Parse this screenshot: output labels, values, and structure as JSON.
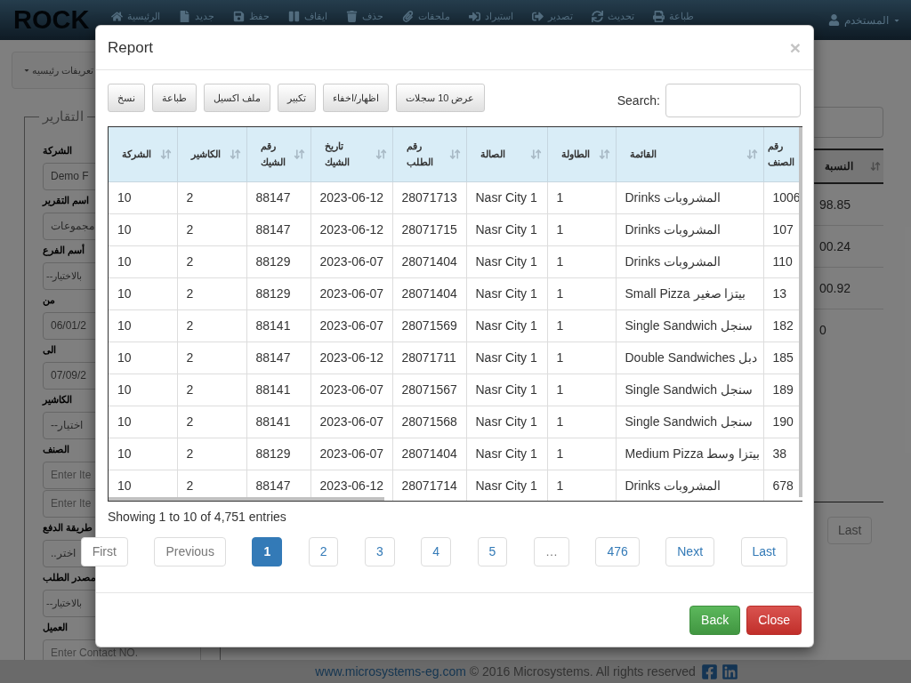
{
  "navbar": {
    "user": "المستخدم",
    "items": [
      "طباعة",
      "تحديث",
      "تصدير",
      "استيراد",
      "ملحقات",
      "حذف",
      "ايقاف",
      "حفظ",
      "جديد",
      "الرئيسية"
    ],
    "logo": "ROCK"
  },
  "subnav": {
    "menu": "تعريفات رئيسيه"
  },
  "reports_form": {
    "legend": "التقارير",
    "fields": [
      {
        "label": "الشركة",
        "inputs": [
          {
            "kind": "text",
            "value": "Demo F"
          }
        ]
      },
      {
        "label": "اسم التقرير",
        "inputs": [
          {
            "kind": "text",
            "value": "مجموعات"
          }
        ]
      },
      {
        "label": "أسم الفرع",
        "inputs": [
          {
            "kind": "select",
            "value": "--بالاختيار"
          }
        ]
      },
      {
        "label": "من",
        "inputs": [
          {
            "kind": "text",
            "value": "06/01/2"
          }
        ]
      },
      {
        "label": "الى",
        "inputs": [
          {
            "kind": "text",
            "value": "07/09/2"
          }
        ]
      },
      {
        "label": "الكاشير",
        "inputs": [
          {
            "kind": "text",
            "value": "--اختيار"
          }
        ]
      },
      {
        "label": "الصنف",
        "inputs": [
          {
            "kind": "text",
            "placeholder": "Enter Ite"
          },
          {
            "kind": "text",
            "placeholder": "Enter Ite"
          }
        ]
      },
      {
        "label": "طريقة الدفع",
        "inputs": [
          {
            "kind": "text",
            "value": "..اختر"
          }
        ]
      },
      {
        "label": "مصدر الطلب",
        "inputs": [
          {
            "kind": "select",
            "value": "--بالاختيار"
          }
        ]
      },
      {
        "label": "العميل",
        "inputs": [
          {
            "kind": "text",
            "placeholder": "Enter Contact NO."
          }
        ]
      }
    ]
  },
  "results_table": {
    "column": "النسبة",
    "values": [
      "98.85",
      "00.24",
      "00.92",
      "0"
    ],
    "pager_button": "Last"
  },
  "footer": {
    "link": "www.microsystems-eg.com",
    "text": "© 2016 Microsystems. All rights reserved"
  },
  "modal": {
    "title": "Report",
    "close": "×",
    "search": {
      "label": "Search:"
    },
    "toolbar": [
      "عرض 10 سجلات",
      "اظهار/اخفاء",
      "تكبير",
      "ملف اكسيل",
      "طباعة",
      "نسخ"
    ],
    "table": {
      "columns": [
        "رقم الصنف",
        "القائمة",
        "الطاولة",
        "الصالة",
        "رقم الطلب",
        "تاريخ الشيك",
        "رقم الشيك",
        "الكاشير",
        "الشركة"
      ],
      "rows": [
        [
          "1006",
          "Drinks المشروبات",
          "1",
          "Nasr City 1",
          "28071713",
          "2023-06-12",
          "88147",
          "2",
          "10"
        ],
        [
          "107",
          "Drinks المشروبات",
          "1",
          "Nasr City 1",
          "28071715",
          "2023-06-12",
          "88147",
          "2",
          "10"
        ],
        [
          "110",
          "Drinks المشروبات",
          "1",
          "Nasr City 1",
          "28071404",
          "2023-06-07",
          "88129",
          "2",
          "10"
        ],
        [
          "13",
          "Small Pizza بيتزا صغير",
          "1",
          "Nasr City 1",
          "28071404",
          "2023-06-07",
          "88129",
          "2",
          "10"
        ],
        [
          "182",
          "Single Sandwich سنجل",
          "1",
          "Nasr City 1",
          "28071569",
          "2023-06-07",
          "88141",
          "2",
          "10"
        ],
        [
          "185",
          "Double Sandwiches دبل",
          "1",
          "Nasr City 1",
          "28071711",
          "2023-06-12",
          "88147",
          "2",
          "10"
        ],
        [
          "189",
          "Single Sandwich سنجل",
          "1",
          "Nasr City 1",
          "28071567",
          "2023-06-07",
          "88141",
          "2",
          "10"
        ],
        [
          "190",
          "Single Sandwich سنجل",
          "1",
          "Nasr City 1",
          "28071568",
          "2023-06-07",
          "88141",
          "2",
          "10"
        ],
        [
          "38",
          "Medium Pizza بيتزا وسط",
          "1",
          "Nasr City 1",
          "28071404",
          "2023-06-07",
          "88129",
          "2",
          "10"
        ],
        [
          "678",
          "Drinks المشروبات",
          "1",
          "Nasr City 1",
          "28071714",
          "2023-06-12",
          "88147",
          "2",
          "10"
        ]
      ]
    },
    "info": "Showing 1 to 10 of 4,751 entries",
    "pagination": [
      {
        "label": "Last",
        "selected": false,
        "disabled": false
      },
      {
        "label": "Next",
        "selected": false,
        "disabled": false
      },
      {
        "label": "476",
        "selected": false,
        "disabled": false
      },
      {
        "label": "…",
        "selected": false,
        "disabled": true
      },
      {
        "label": "5",
        "selected": false,
        "disabled": false
      },
      {
        "label": "4",
        "selected": false,
        "disabled": false
      },
      {
        "label": "3",
        "selected": false,
        "disabled": false
      },
      {
        "label": "2",
        "selected": false,
        "disabled": false
      },
      {
        "label": "1",
        "selected": true,
        "disabled": false
      },
      {
        "label": "Previous",
        "selected": false,
        "disabled": true
      },
      {
        "label": "First",
        "selected": false,
        "disabled": true
      }
    ],
    "buttons": [
      {
        "label": "Close",
        "kind": "danger"
      },
      {
        "label": "Back",
        "kind": "success"
      }
    ]
  }
}
